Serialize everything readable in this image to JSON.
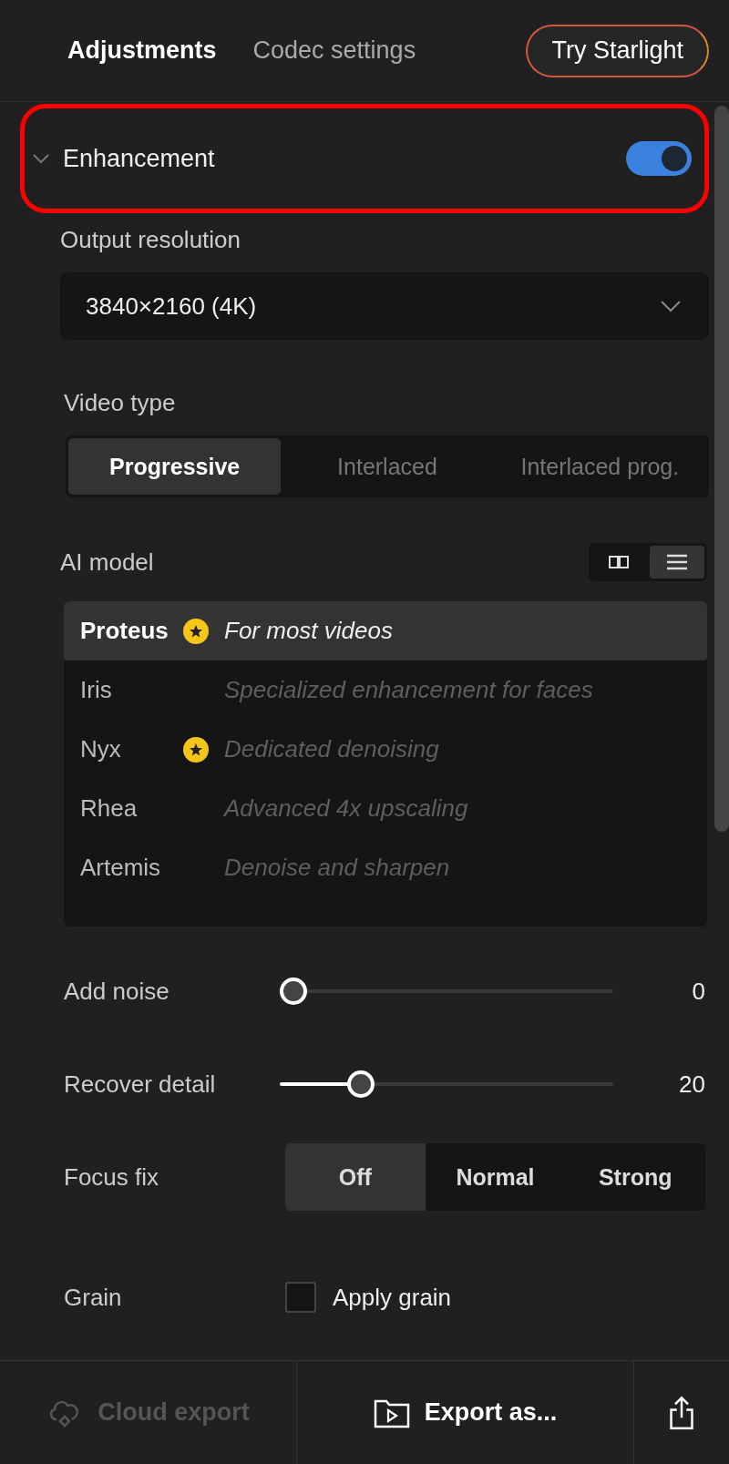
{
  "tabs": [
    {
      "label": "Adjustments",
      "selected": true
    },
    {
      "label": "Codec settings",
      "selected": false
    }
  ],
  "promo_button": {
    "label": "Try Starlight"
  },
  "enhancement": {
    "title": "Enhancement",
    "expanded": true,
    "on": true,
    "highlighted": true
  },
  "output_resolution": {
    "label": "Output resolution",
    "value": "3840×2160 (4K)"
  },
  "video_type": {
    "label": "Video type",
    "options": [
      {
        "label": "Progressive",
        "selected": true
      },
      {
        "label": "Interlaced",
        "selected": false
      },
      {
        "label": "Interlaced prog.",
        "selected": false
      }
    ]
  },
  "ai_model": {
    "label": "AI model",
    "views": [
      {
        "kind": "grid",
        "selected": false
      },
      {
        "kind": "list",
        "selected": true
      }
    ],
    "models": [
      {
        "name": "Proteus",
        "starred": true,
        "description": "For most videos",
        "selected": true
      },
      {
        "name": "Iris",
        "starred": false,
        "description": "Specialized enhancement for faces",
        "selected": false
      },
      {
        "name": "Nyx",
        "starred": true,
        "description": "Dedicated denoising",
        "selected": false
      },
      {
        "name": "Rhea",
        "starred": false,
        "description": "Advanced 4x upscaling",
        "selected": false
      },
      {
        "name": "Artemis",
        "starred": false,
        "description": "Denoise and sharpen",
        "selected": false
      }
    ]
  },
  "sliders": [
    {
      "label": "Add noise",
      "level": 0,
      "reading": "0"
    },
    {
      "label": "Recover detail",
      "level": 0.22,
      "reading": "20"
    }
  ],
  "focus_fix": {
    "label": "Focus fix",
    "options": [
      {
        "label": "Off",
        "selected": true
      },
      {
        "label": "Normal",
        "selected": false
      },
      {
        "label": "Strong",
        "selected": false
      }
    ]
  },
  "grain": {
    "label": "Grain",
    "checkbox": {
      "label": "Apply grain",
      "checked": false
    }
  },
  "footer": {
    "cloud_export": {
      "label": "Cloud export",
      "disabled": true
    },
    "export": {
      "label": "Export as..."
    }
  }
}
